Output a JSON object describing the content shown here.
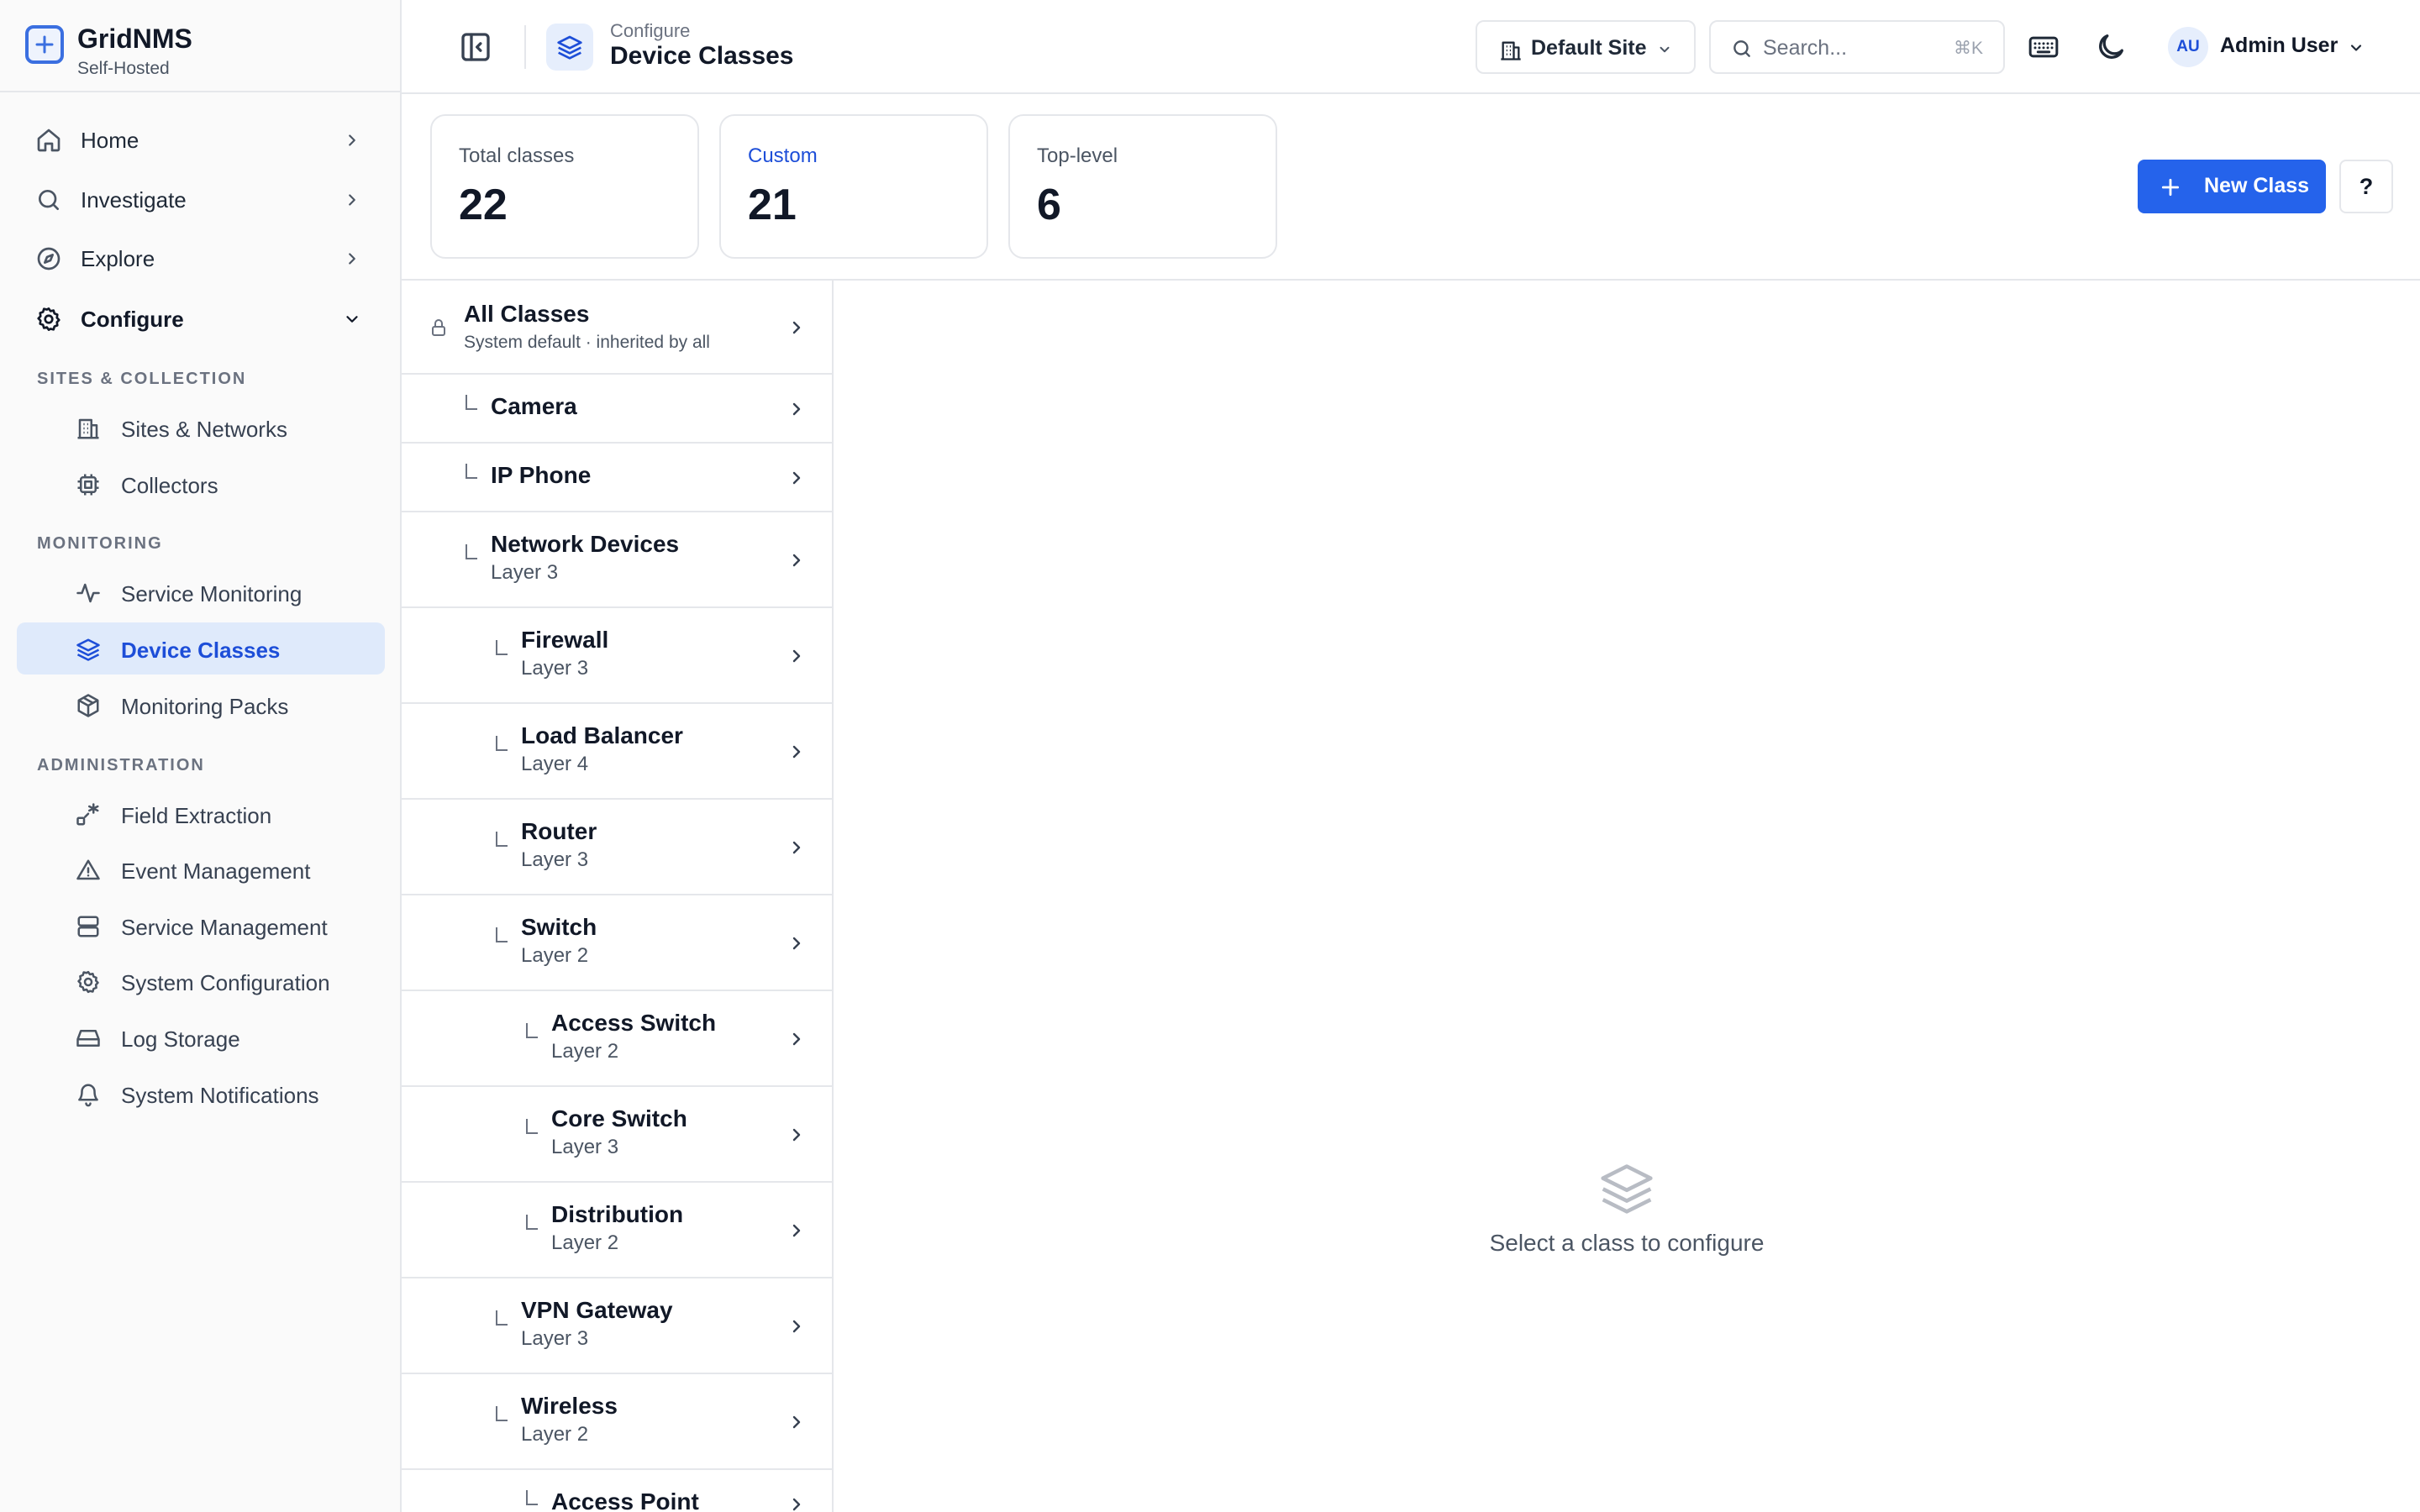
{
  "brand": {
    "name": "GridNMS",
    "subtitle": "Self-Hosted"
  },
  "sidebar": {
    "top_items": [
      {
        "label": "Home",
        "icon": "home-icon"
      },
      {
        "label": "Investigate",
        "icon": "search-icon"
      },
      {
        "label": "Explore",
        "icon": "compass-icon"
      },
      {
        "label": "Configure",
        "icon": "gear-icon",
        "expanded": true
      }
    ],
    "sections": [
      {
        "title": "SITES & COLLECTION",
        "items": [
          {
            "label": "Sites & Networks",
            "icon": "building-icon"
          },
          {
            "label": "Collectors",
            "icon": "cpu-icon"
          }
        ]
      },
      {
        "title": "MONITORING",
        "items": [
          {
            "label": "Service Monitoring",
            "icon": "activity-icon"
          },
          {
            "label": "Device Classes",
            "icon": "layers-icon",
            "active": true
          },
          {
            "label": "Monitoring Packs",
            "icon": "package-icon"
          }
        ]
      },
      {
        "title": "ADMINISTRATION",
        "items": [
          {
            "label": "Field Extraction",
            "icon": "extraction-icon"
          },
          {
            "label": "Event Management",
            "icon": "warning-icon"
          },
          {
            "label": "Service Management",
            "icon": "server-icon"
          },
          {
            "label": "System Configuration",
            "icon": "gear-icon"
          },
          {
            "label": "Log Storage",
            "icon": "hard-drive-icon"
          },
          {
            "label": "System Notifications",
            "icon": "bell-icon"
          }
        ]
      }
    ]
  },
  "header": {
    "breadcrumb": "Configure",
    "title": "Device Classes",
    "site_selector": "Default Site",
    "search_placeholder": "Search...",
    "search_shortcut": "⌘K",
    "user": {
      "initials": "AU",
      "name": "Admin User"
    }
  },
  "stats": [
    {
      "label": "Total classes",
      "value": "22"
    },
    {
      "label": "Custom",
      "value": "21"
    },
    {
      "label": "Top-level",
      "value": "6"
    }
  ],
  "actions": {
    "new_class": "New Class",
    "help": "?"
  },
  "class_tree": [
    {
      "name": "All Classes",
      "sub": "System default · inherited by all",
      "locked": true,
      "depth": 0
    },
    {
      "name": "Camera",
      "sub": "",
      "depth": 1
    },
    {
      "name": "IP Phone",
      "sub": "",
      "depth": 1
    },
    {
      "name": "Network Devices",
      "sub": "Layer 3",
      "depth": 1
    },
    {
      "name": "Firewall",
      "sub": "Layer 3",
      "depth": 2
    },
    {
      "name": "Load Balancer",
      "sub": "Layer 4",
      "depth": 2
    },
    {
      "name": "Router",
      "sub": "Layer 3",
      "depth": 2
    },
    {
      "name": "Switch",
      "sub": "Layer 2",
      "depth": 2
    },
    {
      "name": "Access Switch",
      "sub": "Layer 2",
      "depth": 3
    },
    {
      "name": "Core Switch",
      "sub": "Layer 3",
      "depth": 3
    },
    {
      "name": "Distribution",
      "sub": "Layer 2",
      "depth": 3
    },
    {
      "name": "VPN Gateway",
      "sub": "Layer 3",
      "depth": 2
    },
    {
      "name": "Wireless",
      "sub": "Layer 2",
      "depth": 2
    },
    {
      "name": "Access Point",
      "sub": "",
      "depth": 3
    }
  ],
  "empty_state": {
    "message": "Select a class to configure"
  },
  "colors": {
    "accent": "#2563eb",
    "active_bg": "#dfeafb",
    "active_text": "#1d4ed8",
    "border": "#e5e7eb"
  }
}
